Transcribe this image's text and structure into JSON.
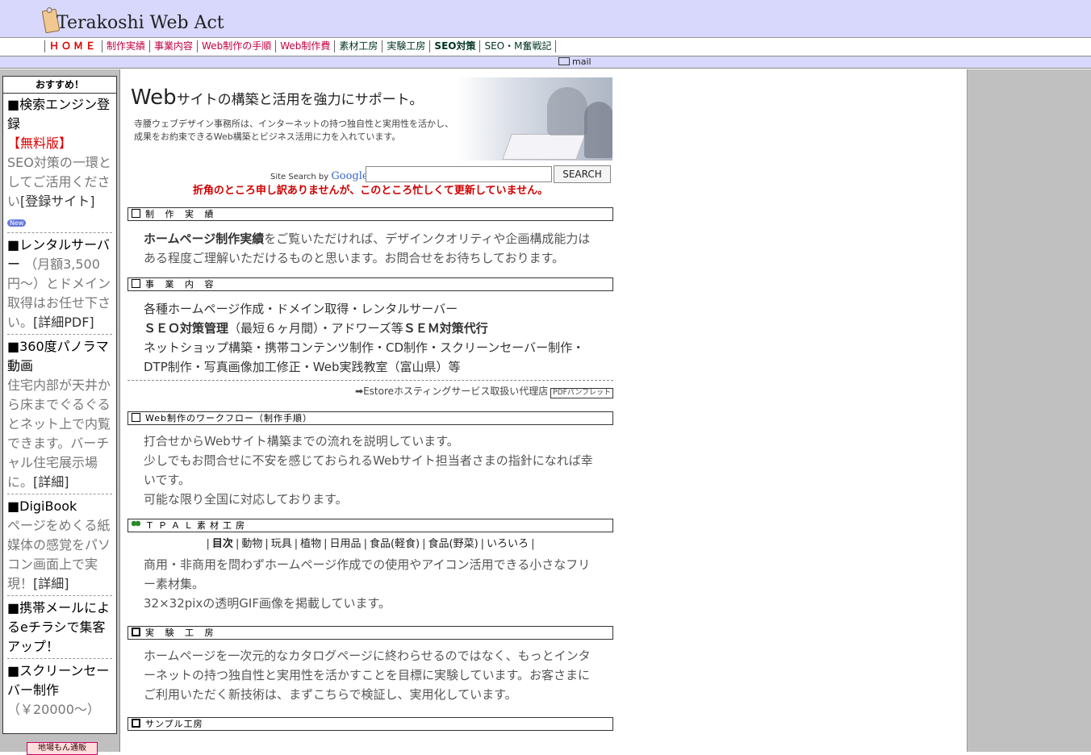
{
  "header": {
    "logo_text": "Terakoshi Web Act"
  },
  "nav": {
    "items": [
      "ＨＯＭＥ",
      "制作実績",
      "事業内容",
      "Web制作の手順",
      "Web制作費",
      "素材工房",
      "実験工房",
      "SEO対策",
      "SEO・M奮戦記"
    ]
  },
  "mail": {
    "label": "mail"
  },
  "sidebar": {
    "heading": "おすすめ！",
    "items": [
      {
        "title": "■検索エンジン登録",
        "red": "【無料版】",
        "desc": "SEO対策の一環としてご活用ください",
        "link": "[登録サイト]",
        "badge": "New"
      },
      {
        "title": "■レンタルサーバー",
        "desc": "（月額3,500円～）とドメイン取得はお任せ下さい。",
        "link": "[詳細PDF]"
      },
      {
        "title": "■360度パノラマ動画",
        "desc": "住宅内部が天井から床までぐるぐるとネット上で内覧できます。バーチャル住宅展示場に。",
        "link": "[詳細]"
      },
      {
        "title": "■DigiBook",
        "desc": "ページをめくる紙媒体の感覚をパソコン画面上で実現！",
        "link": "[詳細]"
      },
      {
        "title": "■携帯メールによるeチラシで集客アップ！"
      },
      {
        "title": "■スクリーンセーバー制作",
        "desc": "（￥20000～）"
      }
    ],
    "shop_button": "地場もん通販"
  },
  "hero": {
    "headline_big": "Web",
    "headline_rest": "サイトの構築と活用を強力にサポート。",
    "desc_line1": "寺腰ウェブデザイン事務所は、インターネットの持つ独自性と実用性を活かし、",
    "desc_line2": "成果をお約束できるWeb構築とビジネス活用に力を入れています。"
  },
  "search": {
    "label": "Site Search by",
    "brand": "Google",
    "placeholder": "",
    "button": "SEARCH"
  },
  "notice": "折角のところ申し訳ありませんが、このところ忙しくて更新していません。",
  "sections": {
    "works": {
      "title": "制 作 実 績",
      "bold": "ホームページ制作実績",
      "body": "をご覧いただければ、デザインクオリティや企画構成能力はある程度ご理解いただけるものと思います。お問合せをお待ちしております。"
    },
    "business": {
      "title": "事 業 内 容",
      "line1": "各種ホームページ作成・ドメイン取得・レンタルサーバー",
      "line2_bold": "ＳＥＯ対策管理",
      "line2_mid": "（最短６ヶ月間）・アドワーズ等",
      "line2_bold2": "ＳＥＭ対策代行",
      "line3": "ネットショップ構築・携帯コンテンツ制作・CD制作・スクリーンセーバー制作・DTP制作・写真画像加工修正・Web実践教室（富山県）等",
      "estore": "Estoreホスティングサービス取扱い代理店",
      "pdf": "PDFパンフレット"
    },
    "workflow": {
      "title": "Web制作のワークフロー（制作手順）",
      "line1": "打合せからWebサイト構築までの流れを説明しています。",
      "line2": "少しでもお問合せに不安を感じておられるWebサイト担当者さまの指針になれば幸いです。",
      "line3": "可能な限り全国に対応しております。"
    },
    "materials": {
      "title": "ＴＰＡＬ素材工房",
      "links": [
        "目次",
        "動物",
        "玩具",
        "植物",
        "日用品",
        "食品(軽食)",
        "食品(野菜)",
        "いろいろ"
      ],
      "line1": "商用・非商用を問わずホームページ作成での使用やアイコン活用できる小さなフリー素材集。",
      "line2": "32×32pixの透明GIF画像を掲載しています。"
    },
    "lab": {
      "title": "実 験 工 房",
      "body": "ホームページを一次元的なカタログページに終わらせるのではなく、もっとインターネットの持つ独自性と実用性を活かすことを目標に実験しています。お客さまにご利用いただく新技術は、まずこちらで検証し、実用化しています。"
    },
    "sample": {
      "title": "サンプル工房"
    }
  }
}
